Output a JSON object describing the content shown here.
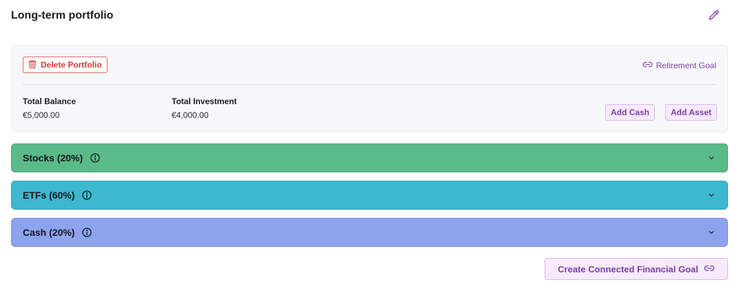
{
  "portfolio": {
    "title": "Long-term portfolio",
    "delete_label": "Delete Portfolio",
    "goal_link_label": "Retirement Goal"
  },
  "stats": {
    "total_balance_label": "Total Balance",
    "total_balance_value": "€5,000.00",
    "total_investment_label": "Total Investment",
    "total_investment_value": "€4,000.00"
  },
  "actions": {
    "add_cash_label": "Add Cash",
    "add_asset_label": "Add Asset",
    "create_goal_label": "Create Connected Financial Goal"
  },
  "sections": [
    {
      "label": "Stocks (20%)",
      "color": "#5bba89"
    },
    {
      "label": "ETFs (60%)",
      "color": "#3cb8cf"
    },
    {
      "label": "Cash (20%)",
      "color": "#8da3ee"
    }
  ],
  "colors": {
    "accent": "#7b3fa8",
    "danger": "#d33a3a"
  },
  "icons": {
    "edit": "pencil-icon",
    "delete": "trash-icon",
    "link": "link-icon",
    "info": "info-icon",
    "expand": "chevron-down-icon"
  }
}
